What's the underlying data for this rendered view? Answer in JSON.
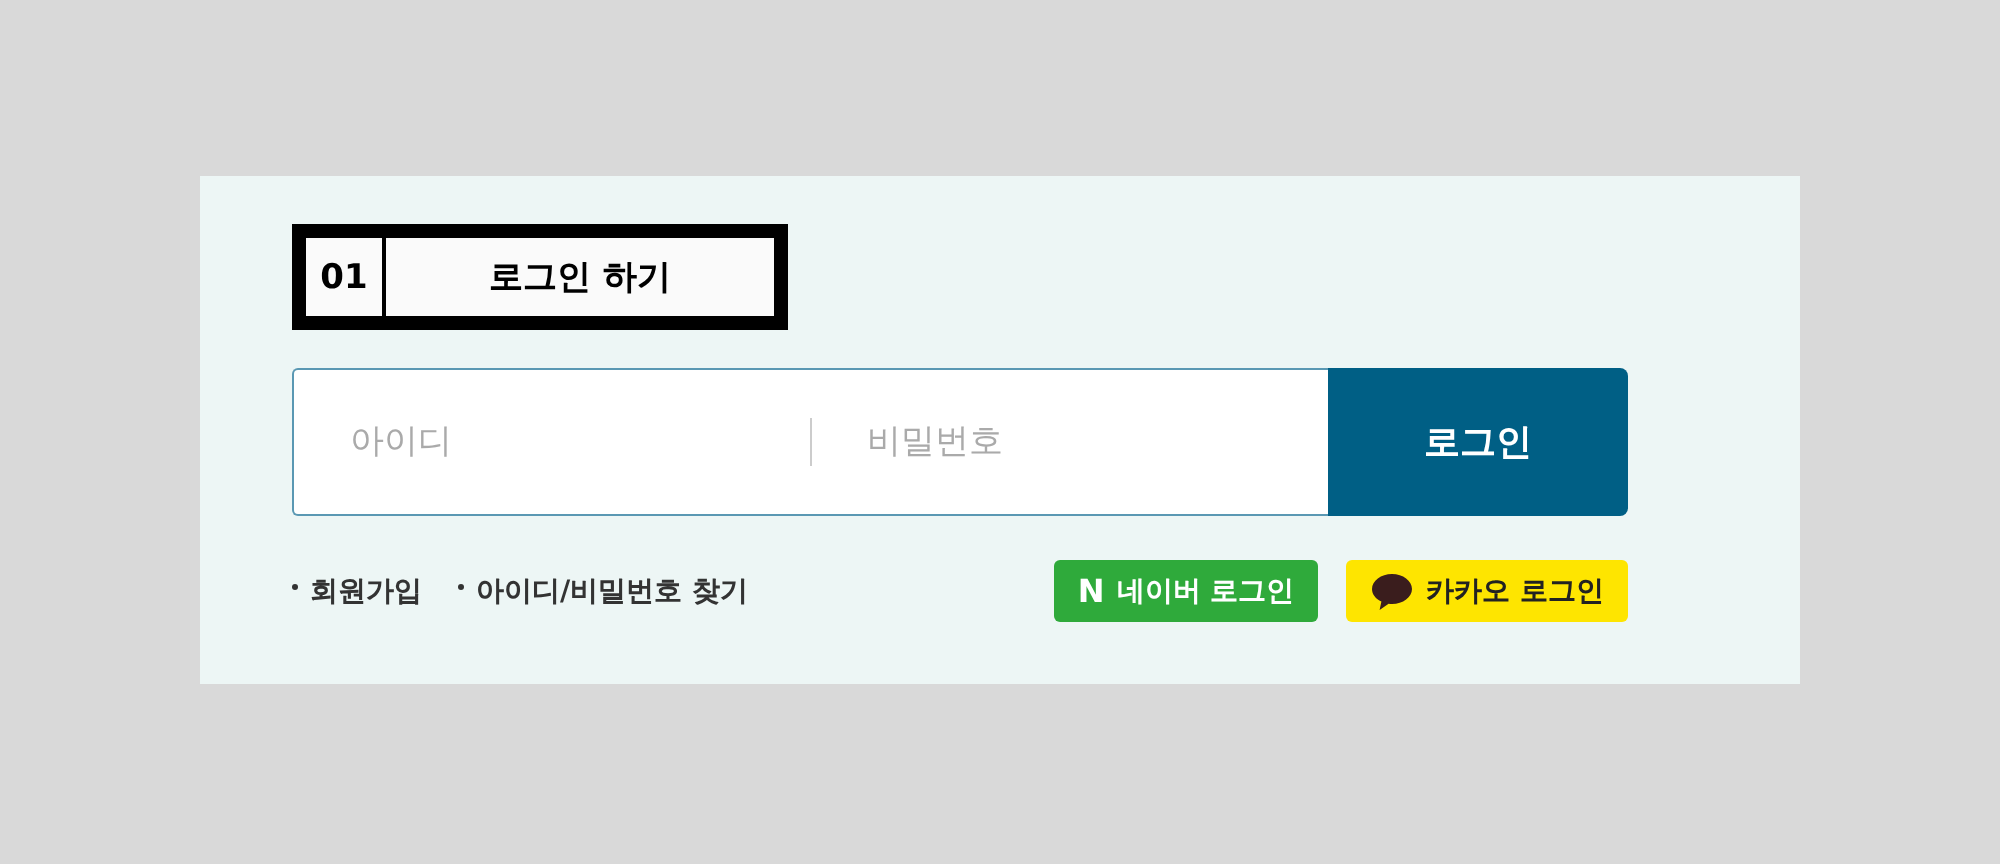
{
  "heading": {
    "number": "01",
    "title": "로그인 하기"
  },
  "login_form": {
    "id_placeholder": "아이디",
    "password_placeholder": "비밀번호",
    "submit": "로그인"
  },
  "links": [
    "회원가입",
    "아이디/비밀번호 찾기"
  ],
  "social_buttons": [
    {
      "kind": "naver",
      "logo": "N",
      "label": "네이버 로그인"
    },
    {
      "kind": "kakao",
      "label": "카카오 로그인"
    }
  ]
}
